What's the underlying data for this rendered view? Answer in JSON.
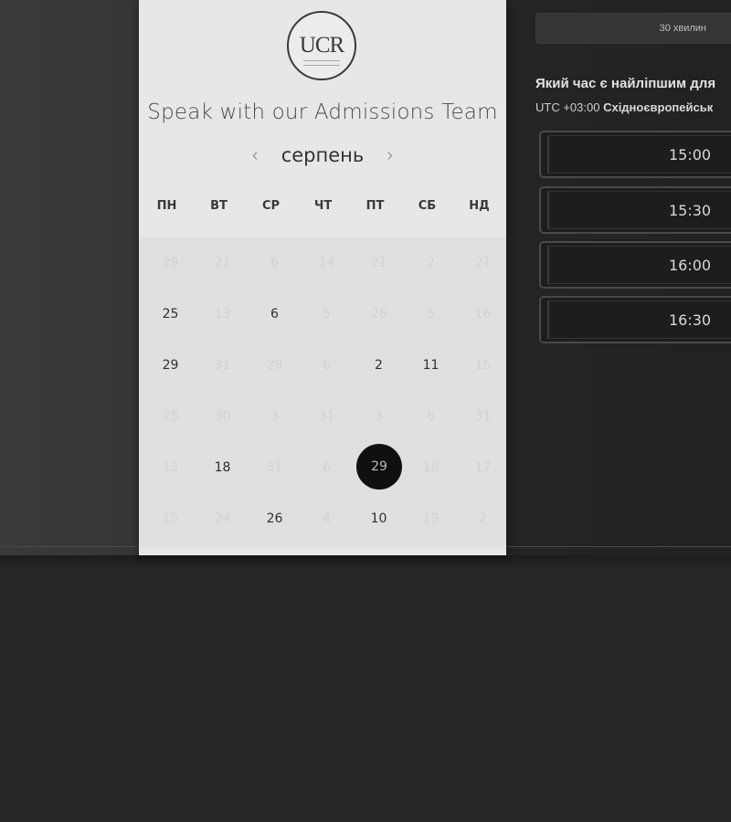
{
  "card": {
    "logo_text": "UCR",
    "title": "Speak with our Admissions Team",
    "month": "серпень",
    "prev_icon": "chevron-left-icon",
    "next_icon": "chevron-right-icon"
  },
  "weekdays": [
    "ПН",
    "ВТ",
    "СР",
    "ЧТ",
    "ПТ",
    "СБ",
    "НД"
  ],
  "calendar_rows": [
    [
      {
        "day": "29",
        "active": false
      },
      {
        "day": "21",
        "active": false
      },
      {
        "day": "6",
        "active": false
      },
      {
        "day": "14",
        "active": false
      },
      {
        "day": "21",
        "active": false
      },
      {
        "day": "2",
        "active": false
      },
      {
        "day": "21",
        "active": false
      }
    ],
    [
      {
        "day": "25",
        "active": true
      },
      {
        "day": "13",
        "active": false
      },
      {
        "day": "6",
        "active": true
      },
      {
        "day": "5",
        "active": false
      },
      {
        "day": "26",
        "active": false
      },
      {
        "day": "5",
        "active": false
      },
      {
        "day": "16",
        "active": false
      }
    ],
    [
      {
        "day": "29",
        "active": true
      },
      {
        "day": "31",
        "active": false
      },
      {
        "day": "29",
        "active": false
      },
      {
        "day": "6",
        "active": false
      },
      {
        "day": "2",
        "active": true
      },
      {
        "day": "11",
        "active": true
      },
      {
        "day": "15",
        "active": false
      }
    ],
    [
      {
        "day": "25",
        "active": false
      },
      {
        "day": "30",
        "active": false
      },
      {
        "day": "3",
        "active": false
      },
      {
        "day": "31",
        "active": false
      },
      {
        "day": "3",
        "active": false
      },
      {
        "day": "6",
        "active": false
      },
      {
        "day": "31",
        "active": false
      }
    ],
    [
      {
        "day": "13",
        "active": false
      },
      {
        "day": "18",
        "active": true
      },
      {
        "day": "31",
        "active": false
      },
      {
        "day": "6",
        "active": false
      },
      {
        "day": "29",
        "active": true,
        "selected": true
      },
      {
        "day": "18",
        "active": false
      },
      {
        "day": "17",
        "active": false
      }
    ],
    [
      {
        "day": "15",
        "active": false
      },
      {
        "day": "24",
        "active": false
      },
      {
        "day": "26",
        "active": true
      },
      {
        "day": "4",
        "active": false
      },
      {
        "day": "10",
        "active": true
      },
      {
        "day": "19",
        "active": false
      },
      {
        "day": "2",
        "active": false
      }
    ]
  ],
  "panel": {
    "duration": "30 хвилин",
    "question": "Який час є найліпшим для",
    "tz_offset": "UTC +03:00",
    "tz_name": "Східноєвропейськ",
    "slots": [
      "15:00",
      "15:30",
      "16:00",
      "16:30"
    ]
  }
}
